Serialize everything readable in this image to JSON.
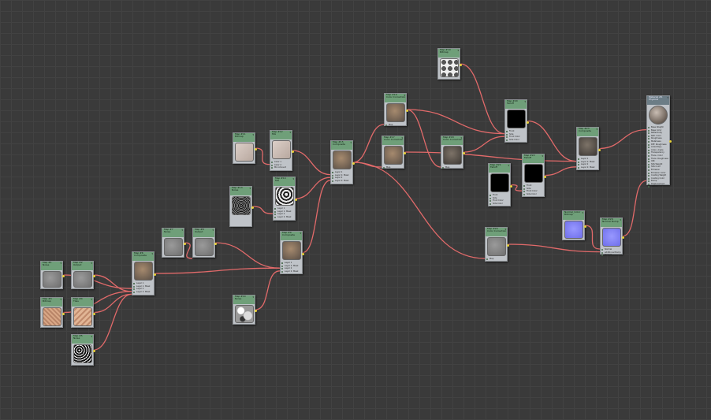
{
  "editor": {
    "background_color": "#3a3a3a",
    "wire_color": "#e26a6a",
    "output_port_color": "#e8d33a",
    "node_header_color": "#6f9f79"
  },
  "nodes": [
    {
      "id": "n1",
      "title": "Map #1",
      "subtitle": "Noise",
      "thumb": "t-gray"
    },
    {
      "id": "n2",
      "title": "Map #2",
      "subtitle": "Output",
      "thumb": "t-gray"
    },
    {
      "id": "n3",
      "title": "Map #3",
      "subtitle": "Bitmap",
      "thumb": "t-skin"
    },
    {
      "id": "n4",
      "title": "Map #4",
      "subtitle": "Tiles",
      "thumb": "t-skin2"
    },
    {
      "id": "n5",
      "title": "Map #5",
      "subtitle": "Noise",
      "thumb": "t-noise"
    },
    {
      "id": "n6",
      "title": "Map #6",
      "subtitle": "Composite",
      "thumb": "t-stone",
      "slots": [
        "",
        "Layer 1",
        "Layer 1: Mask",
        "Layer 2",
        "Layer 2: Mask"
      ]
    },
    {
      "id": "n7",
      "title": "Map #7",
      "subtitle": "Noise",
      "thumb": "t-gray"
    },
    {
      "id": "n8",
      "title": "Map #8",
      "subtitle": "Output",
      "thumb": "t-gray"
    },
    {
      "id": "n9",
      "title": "Map #9",
      "subtitle": "Composite",
      "thumb": "t-stone",
      "slots": [
        "",
        "Layer 1",
        "Layer 1: Mask",
        "Layer 2",
        "Layer 2: Mask"
      ]
    },
    {
      "id": "n10",
      "title": "Map #10",
      "subtitle": "Noise",
      "thumb": "t-mottle"
    },
    {
      "id": "n11",
      "title": "Map #11",
      "subtitle": "Bitmap",
      "thumb": "t-pale"
    },
    {
      "id": "n12",
      "title": "Map #12",
      "subtitle": "Mix",
      "thumb": "t-pale",
      "slots": [
        "Color 1",
        "Color 2",
        "Mix Amount"
      ]
    },
    {
      "id": "n13",
      "title": "Map #13",
      "subtitle": "Noise",
      "thumb": "t-dark"
    },
    {
      "id": "n14",
      "title": "Map #14",
      "subtitle": "Mix",
      "thumb": "t-noise2",
      "slots": [
        "",
        "Layer 1",
        "Layer 1: Mask",
        "Layer 2",
        "Layer 2: Mask"
      ]
    },
    {
      "id": "n15",
      "title": "Map #15",
      "subtitle": "Composite",
      "thumb": "t-stone",
      "slots": [
        "",
        "Layer 1",
        "Layer 1: Mask",
        "Layer 2",
        "Layer 2: Mask"
      ]
    },
    {
      "id": "n16",
      "title": "Map #16",
      "subtitle": "Color Correction",
      "thumb": "t-stone",
      "slots": [
        "Map"
      ]
    },
    {
      "id": "n17",
      "title": "Map #17",
      "subtitle": "Color Correction",
      "thumb": "t-stone",
      "slots": [
        "Map"
      ]
    },
    {
      "id": "n18",
      "title": "Map #18",
      "subtitle": "Color Correction",
      "thumb": "t-stone2",
      "slots": [
        "Map"
      ]
    },
    {
      "id": "n19",
      "title": "Map #19",
      "subtitle": "Bitmap",
      "thumb": "t-grid"
    },
    {
      "id": "n20",
      "title": "Map #20",
      "subtitle": "Falloff",
      "thumb": "t-black",
      "slots": [
        "",
        "Front",
        "Side",
        "Front Color",
        "Side Color"
      ]
    },
    {
      "id": "n21",
      "title": "Map #21",
      "subtitle": "Falloff",
      "thumb": "t-black",
      "slots": [
        "",
        "Front",
        "Side",
        "Front Color",
        "Side Color"
      ]
    },
    {
      "id": "n22",
      "title": "Map #22",
      "subtitle": "Falloff",
      "thumb": "t-black",
      "slots": [
        "",
        "Front",
        "Side",
        "Front Color",
        "Side Color"
      ]
    },
    {
      "id": "n23",
      "title": "Map #23",
      "subtitle": "Composite",
      "thumb": "t-stone2",
      "slots": [
        "",
        "Layer 1",
        "Layer 1: Mask",
        "Layer 2",
        "Layer 2: Mask"
      ]
    },
    {
      "id": "n24",
      "title": "Map #24",
      "subtitle": "Color Correction",
      "thumb": "t-gray",
      "slots": [
        "Map"
      ]
    },
    {
      "id": "n25",
      "title": "Normal_Color",
      "subtitle": "Bitmap",
      "thumb": "t-blue"
    },
    {
      "id": "n26",
      "title": "Map #26",
      "subtitle": "Normal Bump",
      "thumb": "t-blue",
      "slots": [
        "Normal",
        "Additional Bump",
        "Normal"
      ]
    },
    {
      "id": "mat",
      "title": "Material #1",
      "subtitle": "Physical",
      "thumb": "t-ball",
      "dark": true,
      "slots": [
        "Base Weight",
        "Base Color",
        "Reflectivity",
        "Refl. Color",
        "Roughness",
        "Metalness",
        "Diff. Roughness",
        "Anisotropy",
        "Aniso. Angle",
        "Transparency",
        "Trans. Color",
        "Trans. Roughness",
        "IOR",
        "SSS Weight",
        "SSS Color",
        "Emission",
        "Emission Color",
        "Coating Weight",
        "Coating Color",
        "Bump",
        "Displacement",
        "Cutout"
      ]
    }
  ]
}
